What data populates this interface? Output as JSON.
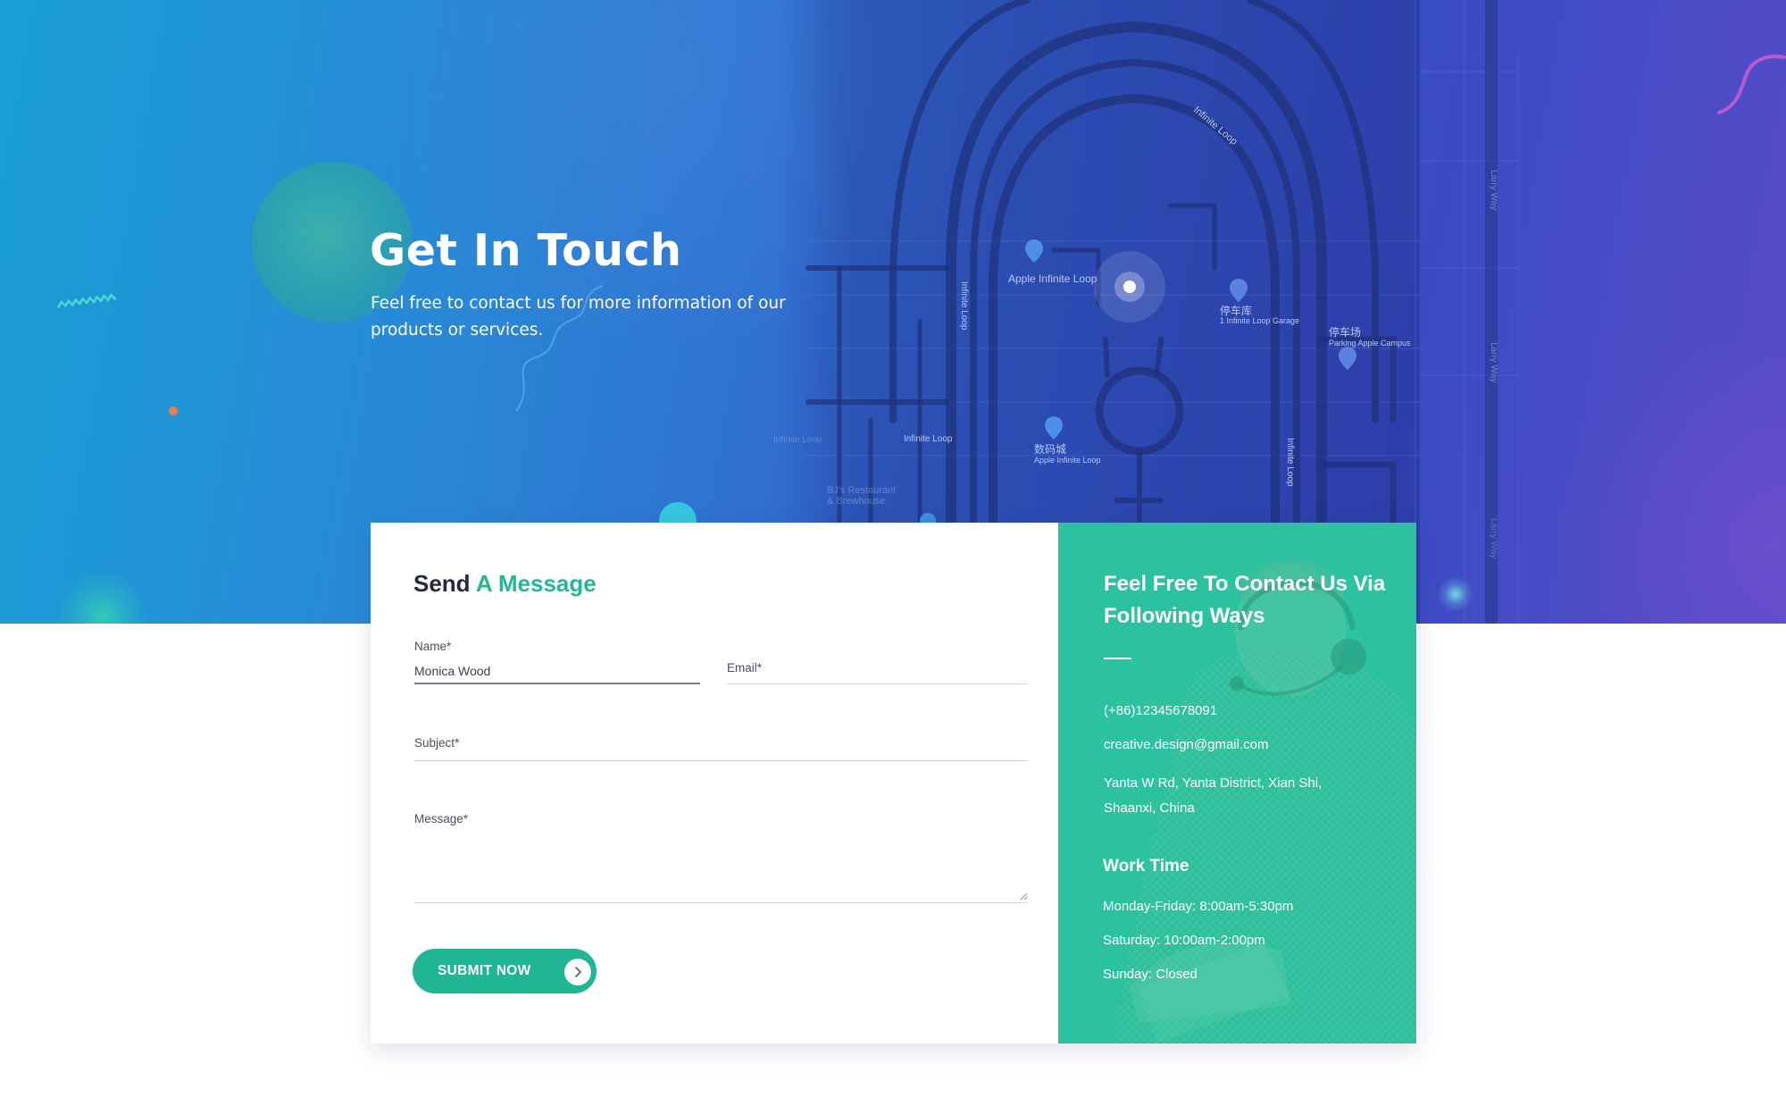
{
  "hero": {
    "title": "Get In Touch",
    "subtitle": "Feel free to contact us for more information of our products or services.",
    "map_labels": {
      "apple_infinite_loop": "Apple Infinite Loop",
      "infinite_loop_diag": "Infinite Loop",
      "garage_cn": "停车库",
      "garage_en": "1 Infinite Loop Garage",
      "parking_cn": "停车场",
      "parking_en": "Parking Apple Campus",
      "infinite_loop_left": "Infinite Loop",
      "infinite_loop_center": "Infinite Loop",
      "infinite_loop_right": "Infinite Loop",
      "infinite_loop_faint": "Infinite Loop",
      "shumacheng_cn": "数码城",
      "shumacheng_en": "Apple Infinite Loop",
      "larry_way_1": "Larry Way",
      "larry_way_2": "Larry Way",
      "larry_way_3": "Larry Way",
      "restaurant_1": "BJ's Restaurant",
      "restaurant_2": "& Brewhouse"
    }
  },
  "form": {
    "title_plain": "Send",
    "title_accent": "A Message",
    "name_label": "Name*",
    "name_value": "Monica Wood",
    "email_label": "Email*",
    "subject_label": "Subject*",
    "message_label": "Message*",
    "submit_label": "SUBMIT NOW"
  },
  "contact": {
    "title": "Feel Free To Contact Us Via Following Ways",
    "phone": "(+86)12345678091",
    "email": "creative.design@gmail.com",
    "address": "Yanta W Rd, Yanta District, Xian Shi, Shaanxi, China",
    "work_title": "Work Time",
    "work_hours": [
      "Monday-Friday: 8:00am-5:30pm",
      "Saturday: 10:00am-2:00pm",
      "Sunday: Closed"
    ]
  },
  "colors": {
    "accent": "#23b796",
    "button": "#1fb595",
    "info_panel": "#2cc2a0",
    "hero_left": "#199fd6",
    "hero_right": "#5a4bc8",
    "orange_dot": "#ee7c4d"
  },
  "icons": {
    "submit_arrow": "chevron-right-icon",
    "map_pin": "map-pin-icon",
    "location_marker": "location-marker-icon"
  }
}
